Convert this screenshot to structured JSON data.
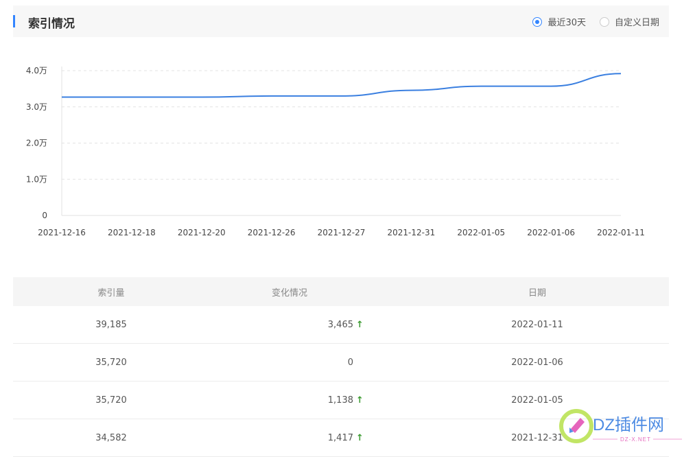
{
  "header": {
    "title": "索引情况"
  },
  "range": {
    "option_recent": "最近30天",
    "option_custom": "自定义日期",
    "selected": "option_recent"
  },
  "colors": {
    "accent": "#3385ff",
    "line": "#3a7fe0",
    "up": "#3a9a2f"
  },
  "chart_data": {
    "type": "line",
    "x": [
      "2021-12-16",
      "2021-12-18",
      "2021-12-20",
      "2021-12-26",
      "2021-12-27",
      "2021-12-31",
      "2022-01-05",
      "2022-01-06",
      "2022-01-11"
    ],
    "y_ticks": [
      "0",
      "1.0万",
      "2.0万",
      "3.0万",
      "4.0万"
    ],
    "ylim": [
      0,
      40000
    ],
    "series": [
      {
        "values": [
          32700,
          32700,
          32700,
          33000,
          33000,
          34582,
          35720,
          35720,
          39185
        ]
      }
    ],
    "grid": true
  },
  "table": {
    "headers": [
      "索引量",
      "变化情况",
      "日期"
    ],
    "rows": [
      {
        "count": "39,185",
        "change": "3,465",
        "up": true,
        "date": "2022-01-11"
      },
      {
        "count": "35,720",
        "change": "0",
        "up": false,
        "date": "2022-01-06"
      },
      {
        "count": "35,720",
        "change": "1,138",
        "up": true,
        "date": "2022-01-05"
      },
      {
        "count": "34,582",
        "change": "1,417",
        "up": true,
        "date": "2021-12-31"
      }
    ]
  },
  "watermark": {
    "brand": "DZ插件网",
    "url": "DZ-X.NET"
  }
}
